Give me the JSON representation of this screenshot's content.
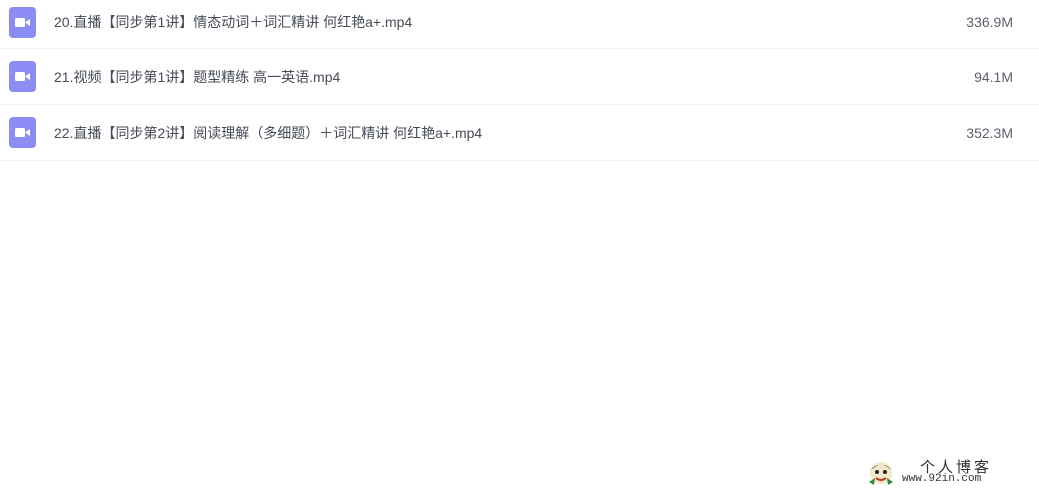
{
  "files": [
    {
      "icon": "video-file-icon",
      "name": "20.直播【同步第1讲】情态动词＋词汇精讲 何红艳a+.mp4",
      "size": "336.9M"
    },
    {
      "icon": "video-file-icon",
      "name": "21.视频【同步第1讲】题型精练 高一英语.mp4",
      "size": "94.1M"
    },
    {
      "icon": "video-file-icon",
      "name": "22.直播【同步第2讲】阅读理解（多细题）＋词汇精讲 何红艳a+.mp4",
      "size": "352.3M"
    }
  ],
  "watermark": {
    "logo": "avatar-logo-icon",
    "title": "个人博客",
    "url": "www.92in.com"
  },
  "colors": {
    "icon_bg": "#8b8df4",
    "text": "#454a57",
    "divider": "#f0f1f4"
  }
}
